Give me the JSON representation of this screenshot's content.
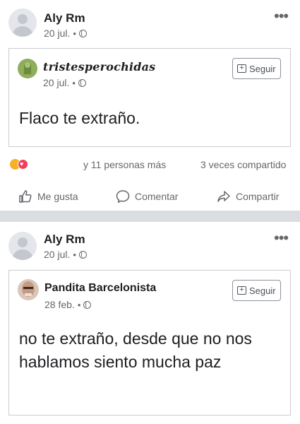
{
  "post1": {
    "author": "Aly Rm",
    "date": "20 jul.",
    "shared": {
      "author": "tristesperochidas",
      "date": "20 jul.",
      "follow_label": "Seguir",
      "text": "Flaco te extraño."
    },
    "reactions_text": "y 11 personas más",
    "shares_text": "3 veces compartido",
    "actions": {
      "like": "Me gusta",
      "comment": "Comentar",
      "share": "Compartir"
    }
  },
  "post2": {
    "author": "Aly Rm",
    "date": "20 jul.",
    "shared": {
      "author": "Pandita Barcelonista",
      "date": "28 feb.",
      "follow_label": "Seguir",
      "text": "no te extraño, desde que no nos hablamos siento mucha paz"
    }
  },
  "colors": {
    "meta": "#65676b",
    "separator": "#dadde1",
    "love": "#f33e58",
    "sad": "#f7b125"
  },
  "icons": [
    "more-icon",
    "globe-icon",
    "follow-icon",
    "like-icon",
    "comment-icon",
    "share-icon",
    "sad-reaction-icon",
    "love-reaction-icon"
  ]
}
